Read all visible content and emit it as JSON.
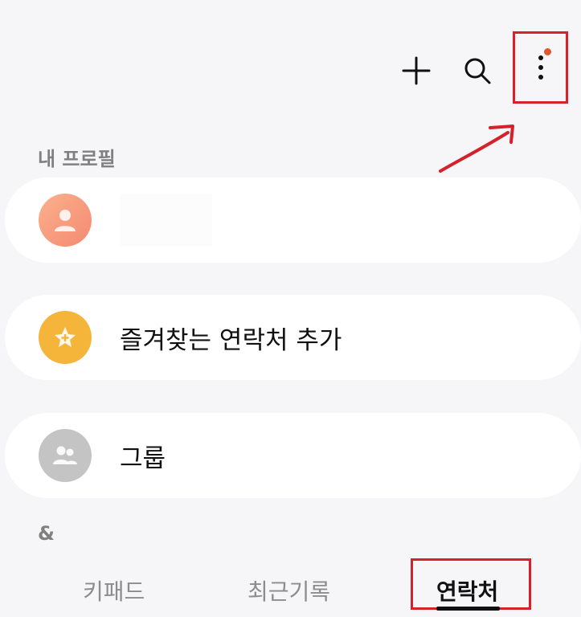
{
  "toolbar": {
    "add_icon": "plus-icon",
    "search_icon": "search-icon",
    "more_icon": "more-vertical-icon",
    "badge_color": "#e3572a",
    "highlight_color": "#d6202c"
  },
  "profile_section": {
    "label": "내 프로필",
    "avatar_color": "#f79c7c",
    "avatar_icon": "person-icon"
  },
  "favorites": {
    "label": "즐겨찾는 연락처 추가",
    "icon": "star-icon",
    "color": "#f5b43a"
  },
  "groups": {
    "label": "그룹",
    "icon": "people-icon",
    "color": "#c4c4c4"
  },
  "index_header": {
    "label": "&"
  },
  "tabs": [
    {
      "label": "키패드",
      "active": false
    },
    {
      "label": "최근기록",
      "active": false
    },
    {
      "label": "연락처",
      "active": true
    }
  ]
}
